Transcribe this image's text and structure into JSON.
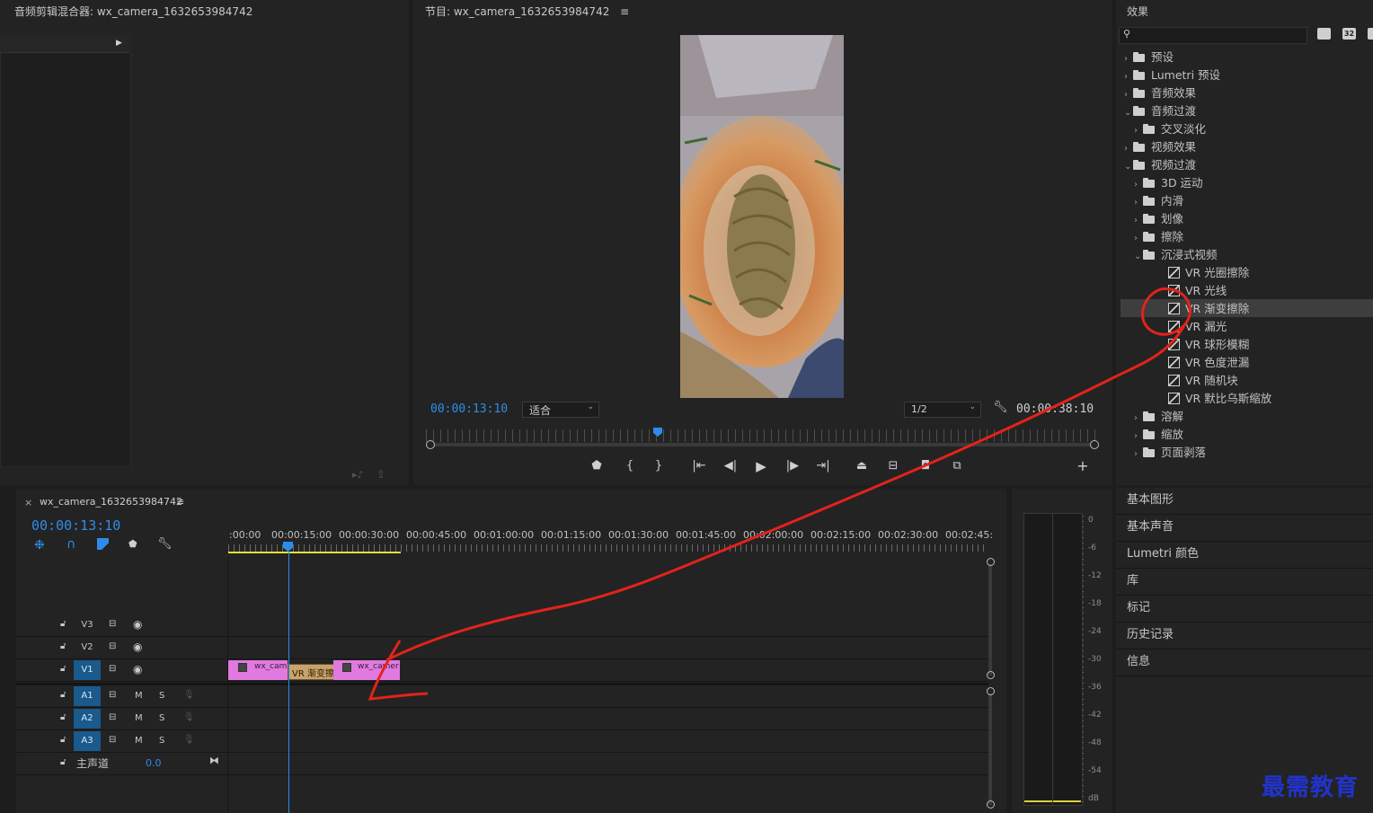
{
  "source_monitor": {
    "title": "音频剪辑混合器: wx_camera_1632653984742"
  },
  "program_monitor": {
    "title": "节目: wx_camera_1632653984742",
    "menu_glyph": "≡",
    "current_time": "00:00:13:10",
    "fit_label": "适合",
    "resolution_label": "1/2",
    "duration": "00:00:38:10"
  },
  "effects": {
    "title": "效果",
    "search_placeholder": "",
    "items": [
      {
        "label": "预设",
        "indent": 0,
        "chev": "›",
        "icon": "preset-folder-icon"
      },
      {
        "label": "Lumetri 预设",
        "indent": 0,
        "chev": "›",
        "icon": "preset-folder-icon"
      },
      {
        "label": "音频效果",
        "indent": 0,
        "chev": "›",
        "icon": "folder-icon"
      },
      {
        "label": "音频过渡",
        "indent": 0,
        "chev": "⌄",
        "icon": "folder-icon"
      },
      {
        "label": "交叉淡化",
        "indent": 1,
        "chev": "›",
        "icon": "folder-icon"
      },
      {
        "label": "视频效果",
        "indent": 0,
        "chev": "›",
        "icon": "folder-icon"
      },
      {
        "label": "视频过渡",
        "indent": 0,
        "chev": "⌄",
        "icon": "folder-icon"
      },
      {
        "label": "3D 运动",
        "indent": 1,
        "chev": "›",
        "icon": "folder-icon"
      },
      {
        "label": "内滑",
        "indent": 1,
        "chev": "›",
        "icon": "folder-icon"
      },
      {
        "label": "划像",
        "indent": 1,
        "chev": "›",
        "icon": "folder-icon"
      },
      {
        "label": "擦除",
        "indent": 1,
        "chev": "›",
        "icon": "folder-icon"
      },
      {
        "label": "沉浸式视频",
        "indent": 1,
        "chev": "⌄",
        "icon": "folder-icon"
      },
      {
        "label": "VR 光圈擦除",
        "indent": 2,
        "chev": "",
        "icon": "transition-icon"
      },
      {
        "label": "VR 光线",
        "indent": 2,
        "chev": "",
        "icon": "transition-icon"
      },
      {
        "label": "VR 渐变擦除",
        "indent": 2,
        "chev": "",
        "icon": "transition-icon",
        "selected": true
      },
      {
        "label": "VR 漏光",
        "indent": 2,
        "chev": "",
        "icon": "transition-icon"
      },
      {
        "label": "VR 球形模糊",
        "indent": 2,
        "chev": "",
        "icon": "transition-icon"
      },
      {
        "label": "VR 色度泄漏",
        "indent": 2,
        "chev": "",
        "icon": "transition-icon"
      },
      {
        "label": "VR 随机块",
        "indent": 2,
        "chev": "",
        "icon": "transition-icon"
      },
      {
        "label": "VR 默比乌斯缩放",
        "indent": 2,
        "chev": "",
        "icon": "transition-icon"
      },
      {
        "label": "溶解",
        "indent": 1,
        "chev": "›",
        "icon": "folder-icon"
      },
      {
        "label": "缩放",
        "indent": 1,
        "chev": "›",
        "icon": "folder-icon"
      },
      {
        "label": "页面剥落",
        "indent": 1,
        "chev": "›",
        "icon": "folder-icon"
      }
    ]
  },
  "side_panels": [
    "基本图形",
    "基本声音",
    "Lumetri 颜色",
    "库",
    "标记",
    "历史记录",
    "信息"
  ],
  "timeline": {
    "close_glyph": "×",
    "sequence_name": "wx_camera_1632653984742",
    "menu_glyph": "≡",
    "current_time": "00:00:13:10",
    "ruler": [
      ":00:00",
      "00:00:15:00",
      "00:00:30:00",
      "00:00:45:00",
      "00:01:00:00",
      "00:01:15:00",
      "00:01:30:00",
      "00:01:45:00",
      "00:02:00:00",
      "00:02:15:00",
      "00:02:30:00",
      "00:02:45:"
    ],
    "tracks": {
      "v3": "V3",
      "v2": "V2",
      "v1": "V1",
      "a1": "A1",
      "a2": "A2",
      "a3": "A3",
      "mute": "M",
      "solo": "S",
      "master": "主声道",
      "master_value": "0.0"
    },
    "clip_left": "wx_cam",
    "transition": "VR 渐变擦",
    "clip_right": "wx_camer"
  },
  "meter": {
    "labels": [
      "0",
      "-6",
      "-12",
      "-18",
      "-24",
      "-30",
      "-36",
      "-42",
      "-48",
      "-54",
      "dB"
    ]
  },
  "watermark": "最需教育",
  "colors": {
    "accent_blue": "#2d8ceb",
    "clip_pink": "#e07ae0",
    "transition_tan": "#c9a36a",
    "annotation_red": "#e2231a",
    "watermark_blue": "#2233cc"
  }
}
